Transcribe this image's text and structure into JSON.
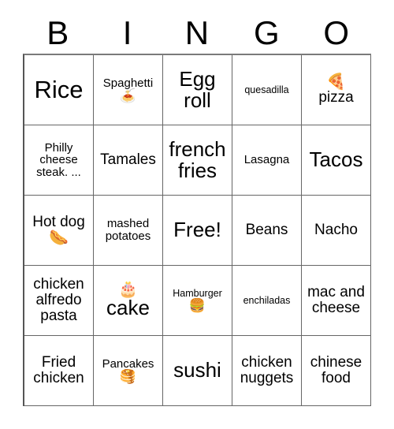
{
  "card": {
    "title_letters": [
      "B",
      "I",
      "N",
      "G",
      "O"
    ],
    "free_space_label": "Free!",
    "grid_size": "5x5",
    "cells": [
      {
        "text": "Rice",
        "emoji": "",
        "emoji_name": "",
        "emoji_pos": "none",
        "size": "fs-xl",
        "free": false
      },
      {
        "text": "Spaghetti",
        "emoji": "🍝",
        "emoji_name": "spaghetti-emoji",
        "emoji_pos": "below",
        "size": "fs-sm",
        "free": false
      },
      {
        "text": "Egg roll",
        "emoji": "",
        "emoji_name": "",
        "emoji_pos": "none",
        "size": "fs-lg",
        "free": false
      },
      {
        "text": "quesadilla",
        "emoji": "",
        "emoji_name": "",
        "emoji_pos": "none",
        "size": "fs-xs",
        "free": false
      },
      {
        "text": "pizza",
        "emoji": "🍕",
        "emoji_name": "pizza-emoji",
        "emoji_pos": "above",
        "size": "fs-md",
        "free": false
      },
      {
        "text": "Philly cheese steak. ...",
        "emoji": "",
        "emoji_name": "",
        "emoji_pos": "none",
        "size": "fs-sm",
        "free": false
      },
      {
        "text": "Tamales",
        "emoji": "",
        "emoji_name": "",
        "emoji_pos": "none",
        "size": "fs-md",
        "free": false
      },
      {
        "text": "french fries",
        "emoji": "",
        "emoji_name": "",
        "emoji_pos": "none",
        "size": "fs-lg",
        "free": false
      },
      {
        "text": "Lasagna",
        "emoji": "",
        "emoji_name": "",
        "emoji_pos": "none",
        "size": "fs-sm",
        "free": false
      },
      {
        "text": "Tacos",
        "emoji": "",
        "emoji_name": "",
        "emoji_pos": "none",
        "size": "fs-lg",
        "free": false
      },
      {
        "text": "Hot dog",
        "emoji": "🌭",
        "emoji_name": "hotdog-emoji",
        "emoji_pos": "inline",
        "size": "fs-md",
        "free": false
      },
      {
        "text": "mashed potatoes",
        "emoji": "",
        "emoji_name": "",
        "emoji_pos": "none",
        "size": "fs-sm",
        "free": false
      },
      {
        "text": "Free!",
        "emoji": "",
        "emoji_name": "",
        "emoji_pos": "none",
        "size": "fs-lg",
        "free": true
      },
      {
        "text": "Beans",
        "emoji": "",
        "emoji_name": "",
        "emoji_pos": "none",
        "size": "fs-md",
        "free": false
      },
      {
        "text": "Nacho",
        "emoji": "",
        "emoji_name": "",
        "emoji_pos": "none",
        "size": "fs-md",
        "free": false
      },
      {
        "text": "chicken alfredo pasta",
        "emoji": "",
        "emoji_name": "",
        "emoji_pos": "none",
        "size": "fs-md",
        "free": false
      },
      {
        "text": "cake",
        "emoji": "🎂",
        "emoji_name": "cake-emoji",
        "emoji_pos": "above",
        "size": "fs-lg",
        "free": false
      },
      {
        "text": "Hamburger",
        "emoji": "🍔",
        "emoji_name": "hamburger-emoji",
        "emoji_pos": "below",
        "size": "fs-xs",
        "free": false
      },
      {
        "text": "enchiladas",
        "emoji": "",
        "emoji_name": "",
        "emoji_pos": "none",
        "size": "fs-xs",
        "free": false
      },
      {
        "text": "mac and cheese",
        "emoji": "",
        "emoji_name": "",
        "emoji_pos": "none",
        "size": "fs-md",
        "free": false
      },
      {
        "text": "Fried chicken",
        "emoji": "",
        "emoji_name": "",
        "emoji_pos": "none",
        "size": "fs-md",
        "free": false
      },
      {
        "text": "Pancakes",
        "emoji": "🥞",
        "emoji_name": "pancakes-emoji",
        "emoji_pos": "below",
        "size": "fs-sm",
        "free": false
      },
      {
        "text": "sushi",
        "emoji": "",
        "emoji_name": "",
        "emoji_pos": "none",
        "size": "fs-lg",
        "free": false
      },
      {
        "text": "chicken nuggets",
        "emoji": "",
        "emoji_name": "",
        "emoji_pos": "none",
        "size": "fs-md",
        "free": false
      },
      {
        "text": "chinese food",
        "emoji": "",
        "emoji_name": "",
        "emoji_pos": "none",
        "size": "fs-md",
        "free": false
      }
    ]
  },
  "colors": {
    "background": "#ffffff",
    "text": "#000000",
    "grid_line": "#666666"
  }
}
